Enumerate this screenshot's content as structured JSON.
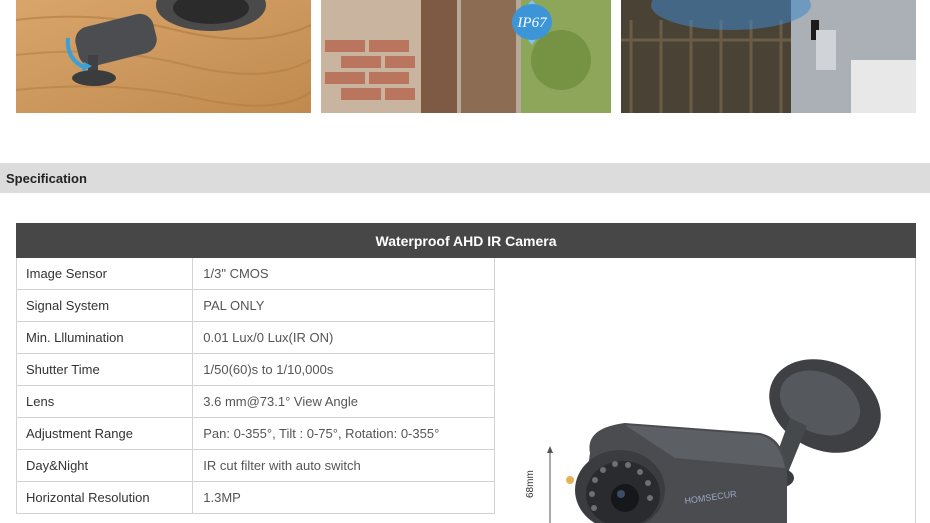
{
  "photos": [
    {
      "name": "camera-rotation-photo"
    },
    {
      "name": "waterproof-photo",
      "badge": "IP67"
    },
    {
      "name": "night-vision-photo"
    }
  ],
  "section": {
    "title": "Specification"
  },
  "table": {
    "title": "Waterproof AHD IR Camera",
    "rows": [
      {
        "label": "Image Sensor",
        "value": "1/3\" CMOS"
      },
      {
        "label": "Signal System",
        "value": "PAL ONLY"
      },
      {
        "label": "Min. Lllumination",
        "value": "0.01 Lux/0 Lux(IR ON)"
      },
      {
        "label": "Shutter Time",
        "value": "1/50(60)s to 1/10,000s"
      },
      {
        "label": "Lens",
        "value": "3.6 mm@73.1° View Angle"
      },
      {
        "label": "Adjustment Range",
        "value": "Pan: 0-355°, Tilt : 0-75°, Rotation: 0-355°"
      },
      {
        "label": "Day&Night",
        "value": "IR cut filter with auto switch"
      },
      {
        "label": "Horizontal Resolution",
        "value": "1.3MP"
      }
    ],
    "product": {
      "dimension": "68mm",
      "brand": "HOMSECUR"
    }
  }
}
